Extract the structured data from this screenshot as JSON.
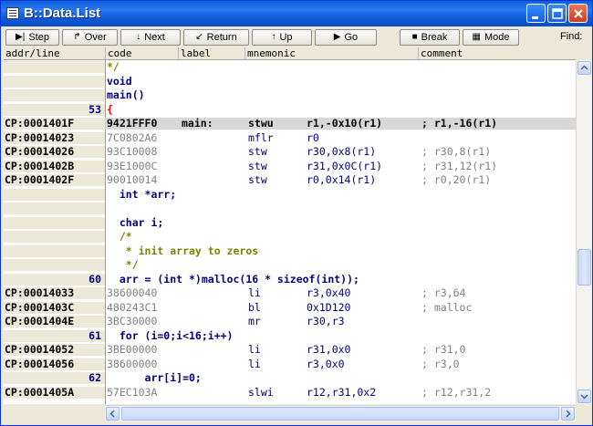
{
  "window": {
    "title": "B::Data.List"
  },
  "toolbar": {
    "buttons": [
      {
        "label": "Step",
        "icon": "step-icon"
      },
      {
        "label": "Over",
        "icon": "step-over-icon"
      },
      {
        "label": "Next",
        "icon": "down-arrow-icon"
      },
      {
        "label": "Return",
        "icon": "return-icon"
      },
      {
        "label": "Up",
        "icon": "up-icon"
      },
      {
        "label": "Go",
        "icon": "play-icon"
      },
      {
        "label": "Break",
        "icon": "stop-icon"
      },
      {
        "label": "Mode",
        "icon": "mode-icon"
      }
    ],
    "find_label": "Find:"
  },
  "columns": {
    "addr": "addr/line",
    "code": "code",
    "label": "label",
    "mnemonic": "mnemonic",
    "comment": "comment"
  },
  "rows": [
    {
      "type": "src",
      "addr": "",
      "text": "*/",
      "cls": "cmt"
    },
    {
      "type": "src",
      "addr": "",
      "text": "void"
    },
    {
      "type": "src",
      "addr": "",
      "text": "main()"
    },
    {
      "type": "src",
      "addr": "53",
      "text": "{",
      "brace": true
    },
    {
      "type": "asm",
      "addr": "CP:0001401F",
      "code": "9421FFF0",
      "label": "main:",
      "mn": "stwu",
      "op": "r1,-0x10(r1)",
      "cm": "; r1,-16(r1)",
      "sel": true
    },
    {
      "type": "asm",
      "addr": "CP:00014023",
      "code": "7C0802A6",
      "label": "",
      "mn": "mflr",
      "op": "r0",
      "cm": ""
    },
    {
      "type": "asm",
      "addr": "CP:00014026",
      "code": "93C10008",
      "label": "",
      "mn": "stw",
      "op": "r30,0x8(r1)",
      "cm": "; r30,8(r1)"
    },
    {
      "type": "asm",
      "addr": "CP:0001402B",
      "code": "93E1000C",
      "label": "",
      "mn": "stw",
      "op": "r31,0x0C(r1)",
      "cm": "; r31,12(r1)"
    },
    {
      "type": "asm",
      "addr": "CP:0001402F",
      "code": "90010014",
      "label": "",
      "mn": "stw",
      "op": "r0,0x14(r1)",
      "cm": "; r0,20(r1)"
    },
    {
      "type": "src",
      "addr": "",
      "text": "  int *arr;"
    },
    {
      "type": "src",
      "addr": "",
      "text": ""
    },
    {
      "type": "src",
      "addr": "",
      "text": "  char i;"
    },
    {
      "type": "src",
      "addr": "",
      "text": "  /*",
      "cls": "cmt"
    },
    {
      "type": "src",
      "addr": "",
      "text": "   * init array to zeros",
      "cls": "cmt"
    },
    {
      "type": "src",
      "addr": "",
      "text": "   */",
      "cls": "cmt"
    },
    {
      "type": "src",
      "addr": "60",
      "text": "  arr = (int *)malloc(16 * sizeof(int));"
    },
    {
      "type": "asm",
      "addr": "CP:00014033",
      "code": "38600040",
      "label": "",
      "mn": "li",
      "op": "r3,0x40",
      "cm": "; r3,64"
    },
    {
      "type": "asm",
      "addr": "CP:0001403C",
      "code": "480243C1",
      "label": "",
      "mn": "bl",
      "op": "0x1D120",
      "cm": "; malloc"
    },
    {
      "type": "asm",
      "addr": "CP:0001404E",
      "code": "3BC30000",
      "label": "",
      "mn": "mr",
      "op": "r30,r3",
      "cm": ""
    },
    {
      "type": "src",
      "addr": "61",
      "text": "  for (i=0;i<16;i++)"
    },
    {
      "type": "asm",
      "addr": "CP:00014052",
      "code": "3BE00000",
      "label": "",
      "mn": "li",
      "op": "r31,0x0",
      "cm": "; r31,0"
    },
    {
      "type": "asm",
      "addr": "CP:00014056",
      "code": "38600000",
      "label": "",
      "mn": "li",
      "op": "r3,0x0",
      "cm": "; r3,0"
    },
    {
      "type": "src",
      "addr": "62",
      "text": "      arr[i]=0;"
    },
    {
      "type": "asm",
      "addr": "CP:0001405A",
      "code": "57EC103A",
      "label": "",
      "mn": "slwi",
      "op": "r12,r31,0x2",
      "cm": "; r12,r31,2"
    }
  ]
}
